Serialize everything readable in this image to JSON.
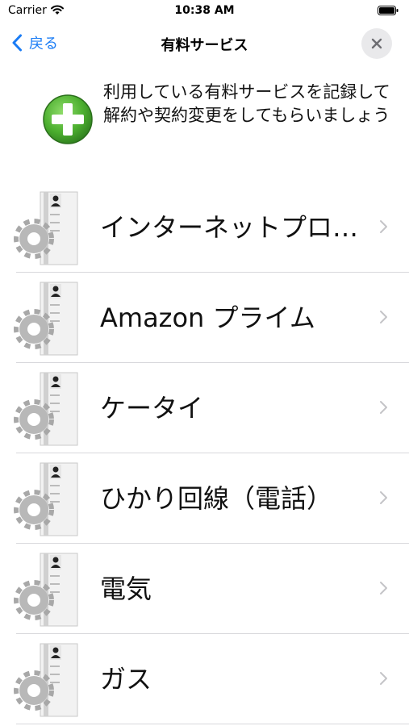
{
  "status_bar": {
    "carrier": "Carrier",
    "time": "10:38 AM"
  },
  "nav": {
    "back_label": "戻る",
    "title": "有料サービス"
  },
  "add_prompt": {
    "text": "利用している有料サービスを記録して解約や契約変更をしてもらいましょう"
  },
  "services": [
    {
      "label": "インターネットプロバイダ"
    },
    {
      "label": "Amazon プライム"
    },
    {
      "label": "ケータイ"
    },
    {
      "label": "ひかり回線（電話）"
    },
    {
      "label": "電気"
    },
    {
      "label": "ガス"
    }
  ],
  "colors": {
    "accent": "#1a7cf5",
    "add_green": "#4caf2f",
    "separator": "#d8d8dc"
  },
  "icons": {
    "back": "chevron-left-icon",
    "close": "close-icon",
    "add": "plus-circle-icon",
    "service": "user-settings-document-icon",
    "row": "chevron-right-icon"
  }
}
